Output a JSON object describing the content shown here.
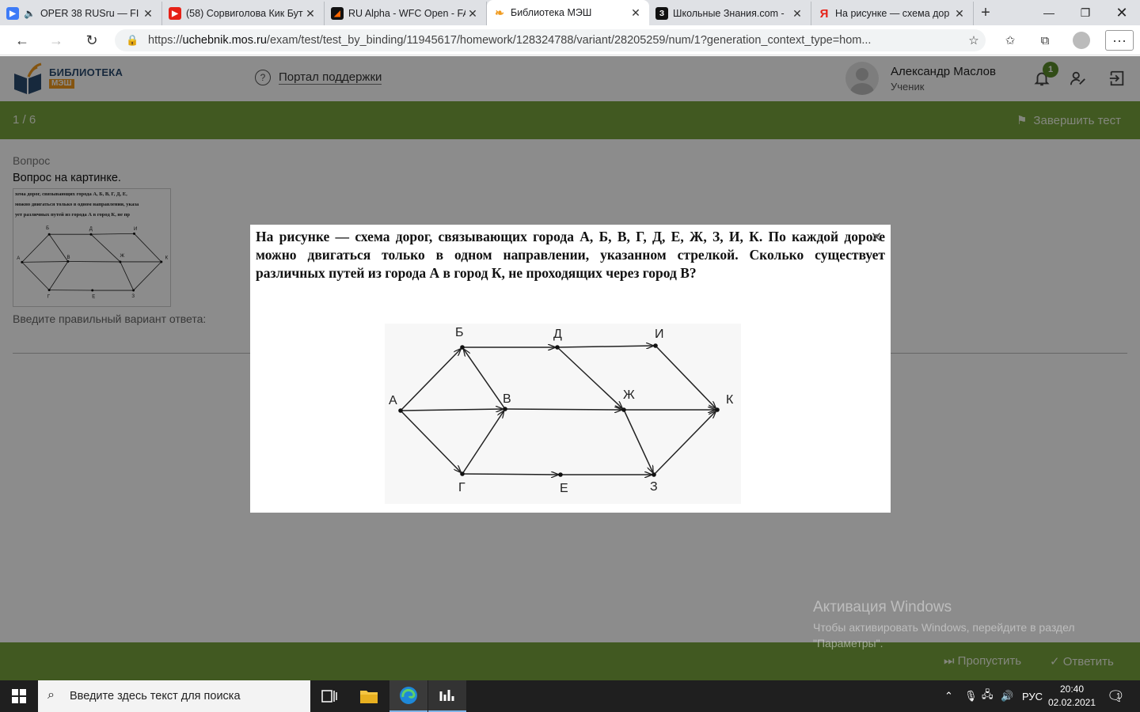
{
  "browser": {
    "tabs": [
      {
        "title": "OPER 38 RUSru — FI",
        "icon": "twitch-icon",
        "color": "#3d7bf7",
        "active": false
      },
      {
        "title": "(58) Сорвиголова Кик Бут",
        "icon": "youtube-icon",
        "color": "#e62117",
        "active": false
      },
      {
        "title": "RU Alpha - WFC Open - FA",
        "icon": "faceit-icon",
        "color": "#111111",
        "active": false
      },
      {
        "title": "Библиотека МЭШ",
        "icon": "mesh-library-icon",
        "color": "#f09a1e",
        "active": true
      },
      {
        "title": "Школьные Знания.com -",
        "icon": "znanija-icon",
        "color": "#111111",
        "active": false
      },
      {
        "title": "На рисунке — схема дор",
        "icon": "yandex-icon",
        "color": "#e62117",
        "active": false
      }
    ],
    "url_prefix": "https://",
    "url_domain": "uchebnik.mos.ru",
    "url_path": "/exam/test/test_by_binding/11945617/homework/128324788/variant/28205259/num/1?generation_context_type=hom..."
  },
  "header": {
    "logo_title": "БИБЛИОТЕКА",
    "logo_sub": "МЭШ",
    "support_label": "Портал поддержки",
    "user_name": "Александр Маслов",
    "user_role": "Ученик",
    "notifications_count": "1"
  },
  "progress": {
    "counter": "1 / 6",
    "finish_label": "Завершить тест"
  },
  "question": {
    "label": "Вопрос",
    "text": "Вопрос на картинке.",
    "hint": "Введите правильный вариант ответа:",
    "thumb_lines": [
      "хема дорог, связывающих города А, Б, В, Г, Д, Е,",
      "можно двигаться только в одном направлении, указа",
      "ует различных путей из города А в город К, не пр"
    ]
  },
  "footer": {
    "skip_label": "Пропустить",
    "answer_label": "Ответить"
  },
  "modal": {
    "problem_text": "На рисунке — схема дорог, связывающих города А, Б, В, Г, Д, Е, Ж, З, И, К. По каждой дороге можно двигаться только в одном направлении, указанном стрелкой. Сколько существует различных путей из города А в город К, не проходящих через город В?",
    "graph": {
      "nodes": [
        {
          "id": "А",
          "label": "А"
        },
        {
          "id": "Б",
          "label": "Б"
        },
        {
          "id": "В",
          "label": "В"
        },
        {
          "id": "Г",
          "label": "Г"
        },
        {
          "id": "Д",
          "label": "Д"
        },
        {
          "id": "Е",
          "label": "Е"
        },
        {
          "id": "Ж",
          "label": "Ж"
        },
        {
          "id": "З",
          "label": "З"
        },
        {
          "id": "И",
          "label": "И"
        },
        {
          "id": "К",
          "label": "К"
        }
      ],
      "edges": [
        [
          "А",
          "Б"
        ],
        [
          "А",
          "В"
        ],
        [
          "А",
          "Г"
        ],
        [
          "В",
          "Б"
        ],
        [
          "Г",
          "В"
        ],
        [
          "Б",
          "Д"
        ],
        [
          "Д",
          "И"
        ],
        [
          "Д",
          "Ж"
        ],
        [
          "В",
          "Ж"
        ],
        [
          "Г",
          "Е"
        ],
        [
          "Е",
          "З"
        ],
        [
          "Ж",
          "З"
        ],
        [
          "Ж",
          "К"
        ],
        [
          "И",
          "К"
        ],
        [
          "З",
          "К"
        ]
      ]
    }
  },
  "windows_activation": {
    "title": "Активация Windows",
    "text": "Чтобы активировать Windows, перейдите в раздел \"Параметры\"."
  },
  "taskbar": {
    "search_placeholder": "Введите здесь текст для поиска",
    "language": "РУС",
    "time": "20:40",
    "date": "02.02.2021",
    "notification_count": "1"
  }
}
